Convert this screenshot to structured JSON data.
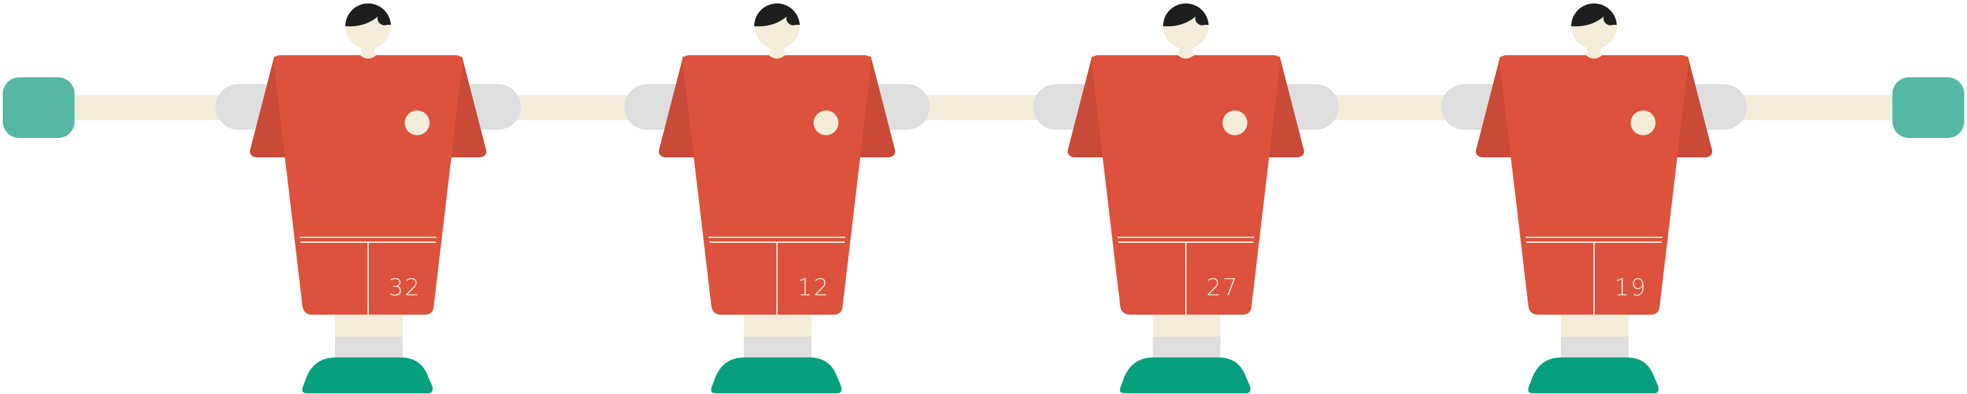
{
  "colors": {
    "rod": "#f2ecd9",
    "sleeve": "#dedede",
    "handle": "#55b8a4",
    "shirt": "#dc523c",
    "shirt_side": "#c94a37",
    "hair": "#1e1e1e",
    "skin": "#f2ecd9",
    "button": "#f2ecd9",
    "sock_top": "#f2ecd9",
    "sock_band": "#dedede",
    "shoe": "#07a07e",
    "line": "#f2ecd9",
    "number": "#f2ecd9"
  },
  "players": [
    {
      "number": "32"
    },
    {
      "number": "12"
    },
    {
      "number": "27"
    },
    {
      "number": "19"
    }
  ]
}
